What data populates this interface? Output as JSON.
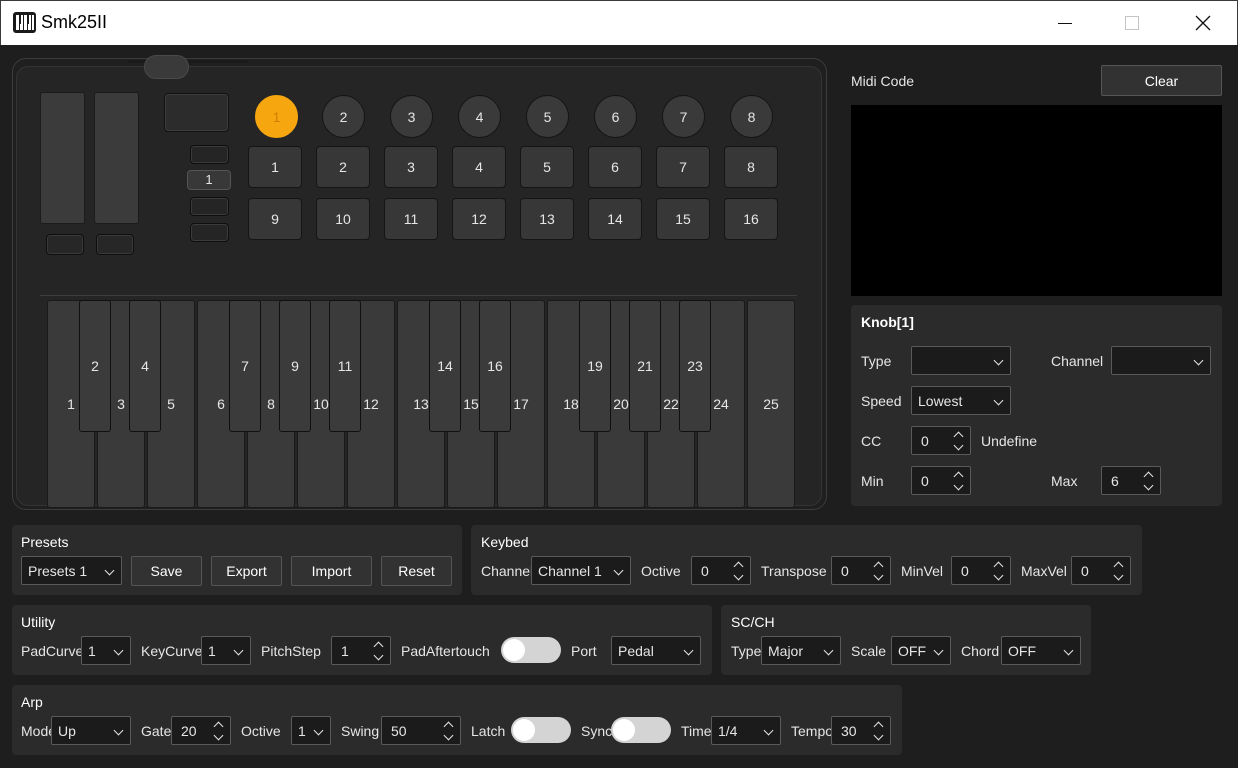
{
  "window": {
    "title": "Smk25II"
  },
  "device": {
    "octave_value": "1",
    "knobs": [
      "1",
      "2",
      "3",
      "4",
      "5",
      "6",
      "7",
      "8"
    ],
    "active_knob": 0,
    "pads_row1": [
      "1",
      "2",
      "3",
      "4",
      "5",
      "6",
      "7",
      "8"
    ],
    "pads_row2": [
      "9",
      "10",
      "11",
      "12",
      "13",
      "14",
      "15",
      "16"
    ],
    "white_keys": [
      "1",
      "3",
      "5",
      "6",
      "8",
      "10",
      "12",
      "13",
      "15",
      "17",
      "18",
      "20",
      "22",
      "24",
      "25"
    ],
    "black_keys": [
      "2",
      "4",
      "7",
      "9",
      "11",
      "14",
      "16",
      "19",
      "21",
      "23"
    ]
  },
  "midi": {
    "label": "Midi Code",
    "clear_label": "Clear"
  },
  "knob_panel": {
    "title": "Knob[1]",
    "type_label": "Type",
    "type_value": "",
    "channel_label": "Channel",
    "channel_value": "",
    "speed_label": "Speed",
    "speed_value": "Lowest",
    "cc_label": "CC",
    "cc_value": "0",
    "cc_desc": "Undefine",
    "min_label": "Min",
    "min_value": "0",
    "max_label": "Max",
    "max_value": "6"
  },
  "presets": {
    "title": "Presets",
    "select_value": "Presets 1",
    "save_label": "Save",
    "export_label": "Export",
    "import_label": "Import",
    "reset_label": "Reset"
  },
  "keybed": {
    "title": "Keybed",
    "channel_label": "Channel",
    "channel_value": "Channel 1",
    "octive_label": "Octive",
    "octive_value": "0",
    "transpose_label": "Transpose",
    "transpose_value": "0",
    "minvel_label": "MinVel",
    "minvel_value": "0",
    "maxvel_label": "MaxVel",
    "maxvel_value": "0"
  },
  "utility": {
    "title": "Utility",
    "padcurve_label": "PadCurve",
    "padcurve_value": "1",
    "keycurve_label": "KeyCurve",
    "keycurve_value": "1",
    "pitchstep_label": "PitchStep",
    "pitchstep_value": "1",
    "padaftertouch_label": "PadAftertouch",
    "port_label": "Port",
    "port_value": "Pedal"
  },
  "scch": {
    "title": "SC/CH",
    "type_label": "Type",
    "type_value": "Major",
    "scale_label": "Scale",
    "scale_value": "OFF",
    "chord_label": "Chord",
    "chord_value": "OFF"
  },
  "arp": {
    "title": "Arp",
    "mode_label": "Mode",
    "mode_value": "Up",
    "gate_label": "Gate",
    "gate_value": "20",
    "octive_label": "Octive",
    "octive_value": "1",
    "swing_label": "Swing",
    "swing_value": "50",
    "latch_label": "Latch",
    "sync_label": "Sync",
    "time_label": "Time",
    "time_value": "1/4",
    "tempo_label": "Tempo",
    "tempo_value": "30"
  }
}
